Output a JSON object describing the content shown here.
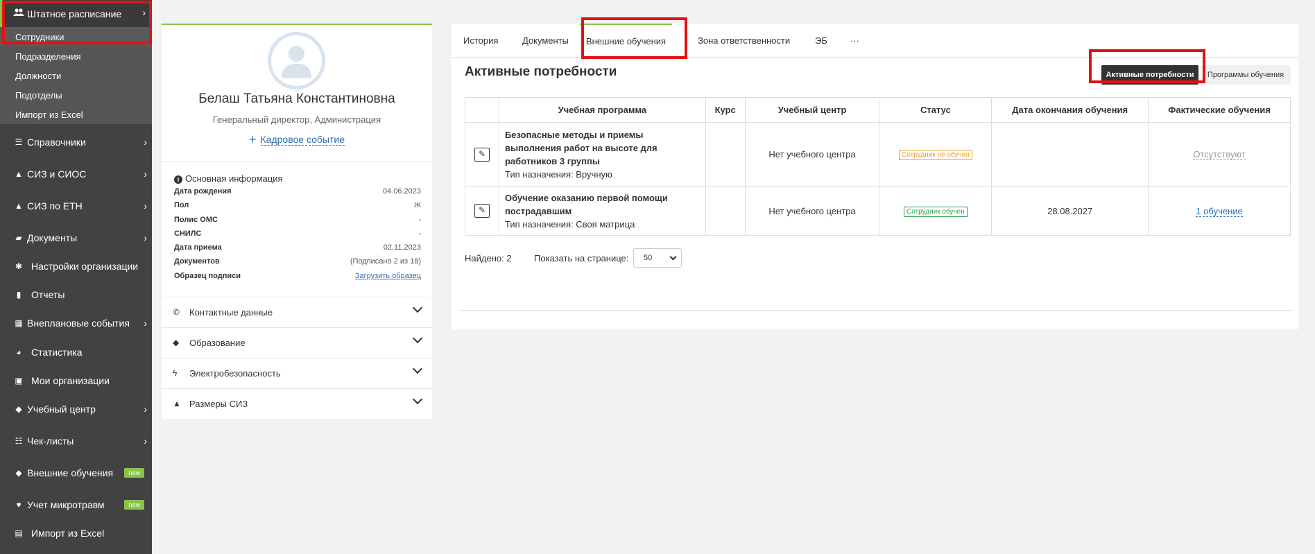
{
  "sidebar": {
    "group_title": "Штатное расписание",
    "sub_items": [
      "Сотрудники",
      "Подразделения",
      "Должности",
      "Подотделы",
      "Импорт из Excel"
    ],
    "items": [
      {
        "label": "Справочники",
        "icon": "list-icon",
        "has_chevron": true
      },
      {
        "label": "СИЗ и СИОС",
        "icon": "ppe-icon",
        "has_chevron": true
      },
      {
        "label": "СИЗ по ЕТН",
        "icon": "ppe-icon",
        "has_chevron": true
      },
      {
        "label": "Документы",
        "icon": "folder-icon",
        "has_chevron": true
      },
      {
        "label": "Настройки организации",
        "icon": "gear-icon",
        "has_chevron": false
      },
      {
        "label": "Отчеты",
        "icon": "clipboard-icon",
        "has_chevron": false
      },
      {
        "label": "Внеплановые события",
        "icon": "calendar-icon",
        "has_chevron": true
      },
      {
        "label": "Статистика",
        "icon": "pie-chart-icon",
        "has_chevron": false
      },
      {
        "label": "Мои организации",
        "icon": "briefcase-icon",
        "has_chevron": false
      },
      {
        "label": "Учебный центр",
        "icon": "graduation-cap-icon",
        "has_chevron": true
      },
      {
        "label": "Чек-листы",
        "icon": "checklist-icon",
        "has_chevron": true
      },
      {
        "label": "Внешние обучения",
        "icon": "graduation-cap-icon",
        "badge": "new"
      },
      {
        "label": "Учет микротравм",
        "icon": "heartbeat-icon",
        "badge": "new"
      },
      {
        "label": "Импорт из Excel",
        "icon": "file-excel-icon",
        "has_chevron": false
      }
    ]
  },
  "profile": {
    "name": "Белаш Татьяна Константиновна",
    "role": "Генеральный директор, Администрация",
    "event_link": "Кадровое событие",
    "info_title": "Основная информация",
    "info": [
      {
        "key": "Дата рождения",
        "value": "04.06.2023"
      },
      {
        "key": "Пол",
        "value": "Ж"
      },
      {
        "key": "Полис ОМС",
        "value": "-"
      },
      {
        "key": "СНИЛС",
        "value": "-"
      },
      {
        "key": "Дата приема",
        "value": "02.11.2023"
      },
      {
        "key": "Документов",
        "value": "(Подписано 2 из 18)"
      },
      {
        "key": "Образец подписи",
        "value": "Загрузить образец"
      }
    ],
    "sections": [
      "Контактные данные",
      "Образование",
      "Электробезопасность",
      "Размеры СИЗ"
    ]
  },
  "main": {
    "tabs": [
      "История",
      "Документы",
      "Внешние обучения",
      "Зона ответственности",
      "ЭБ",
      "···"
    ],
    "active_tab": "Внешние обучения",
    "section_title": "Активные потребности",
    "buttons": {
      "active": "Активные потребности",
      "programs": "Программы обучения"
    },
    "table": {
      "headers": [
        "Учебная программа",
        "Курс",
        "Учебный центр",
        "Статус",
        "Дата окончания обучения",
        "Фактические обучения"
      ],
      "rows": [
        {
          "program": "Безопасные методы и приемы выполнения работ на высоте для работников 3 группы",
          "assign_type": "Тип назначения: Вручную",
          "course": "",
          "center": "Нет учебного центра",
          "status": "Сотрудник не обучен",
          "end_date": "",
          "actual": "Отсутствуют"
        },
        {
          "program": "Обучение оказанию первой помощи пострадавшим",
          "assign_type": "Тип назначения: Своя матрица",
          "course": "",
          "center": "Нет учебного центра",
          "status": "Сотрудник обучен",
          "end_date": "28.08.2027",
          "actual": "1 обучение"
        }
      ]
    },
    "found": "Найдено: 2",
    "per_page_label": "Показать на странице:",
    "per_page_value": "50"
  },
  "colors": {
    "sidebar_bg": "#424242",
    "accent_green": "#8bc34a",
    "highlight_red": "#e01414",
    "link_blue": "#2c6eb5",
    "status_orange": "#f0a020",
    "status_green": "#2e9e4e"
  }
}
